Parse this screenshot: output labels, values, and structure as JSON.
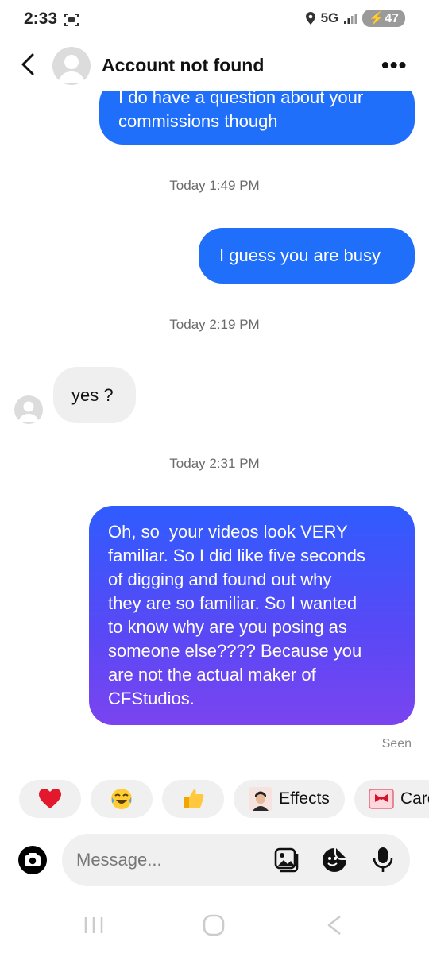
{
  "status_bar": {
    "time": "2:33",
    "network": "5G",
    "battery": "47"
  },
  "header": {
    "title": "Account not found"
  },
  "messages": [
    {
      "text": "I do have a question about your commissions though"
    },
    {
      "timestamp": "Today 1:49 PM"
    },
    {
      "text": "I guess you are busy"
    },
    {
      "timestamp": "Today 2:19 PM"
    },
    {
      "text": "yes ?"
    },
    {
      "timestamp": "Today 2:31 PM"
    },
    {
      "lines": [
        "Oh, so  your videos look VERY",
        "familiar. So I did like five seconds",
        "of digging and found out why",
        "they are so familiar. So I wanted",
        "to know why are you posing as",
        "someone else???? Because you",
        "are not the actual maker of",
        "CFStudios."
      ]
    },
    {
      "status": "Seen"
    }
  ],
  "reactions": [
    {
      "icon": "heart-icon"
    },
    {
      "icon": "laughing-emoji-icon"
    },
    {
      "icon": "thumbs-up-icon"
    },
    {
      "label": "Effects",
      "icon": "effects-avatar-icon"
    },
    {
      "label": "Cards",
      "icon": "card-icon"
    }
  ],
  "composer": {
    "placeholder": "Message..."
  },
  "colors": {
    "bubble_blue": "#1f6ffb",
    "bubble_gradient_top": "#2f5cff",
    "bubble_gradient_bottom": "#7a44f0",
    "incoming_bubble": "#efefef"
  }
}
